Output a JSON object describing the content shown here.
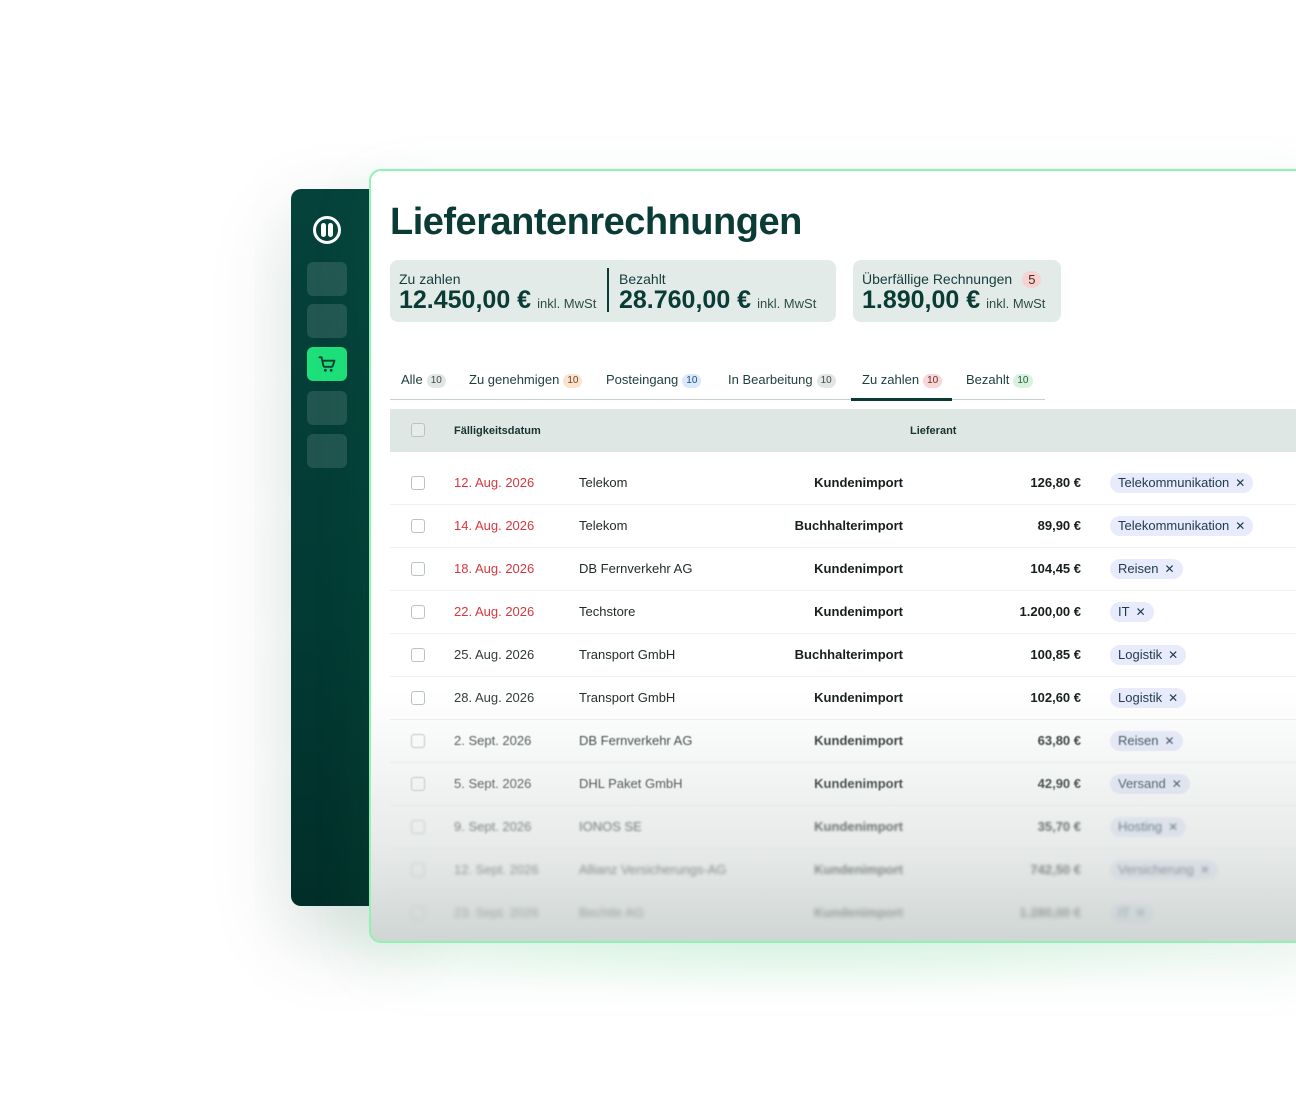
{
  "page": {
    "title": "Lieferantenrechnungen"
  },
  "sidebar": {
    "items": [
      "logo",
      "item-1",
      "item-2",
      "purchases",
      "item-4",
      "item-5"
    ],
    "active_color": "#1ee07a"
  },
  "summary": {
    "to_pay": {
      "label": "Zu zahlen",
      "value": "12.450,00 €",
      "unit": "inkl. MwSt"
    },
    "paid": {
      "label": "Bezahlt",
      "value": "28.760,00 €",
      "unit": "inkl. MwSt"
    },
    "overdue": {
      "label": "Überfällige Rechnungen",
      "count": "5",
      "value": "1.890,00 €",
      "unit": "inkl. MwSt"
    }
  },
  "tabs": [
    {
      "label": "Alle",
      "count": "10"
    },
    {
      "label": "Zu genehmigen",
      "count": "10"
    },
    {
      "label": "Posteingang",
      "count": "10"
    },
    {
      "label": "In Bearbeitung",
      "count": "10"
    },
    {
      "label": "Zu zahlen",
      "count": "10",
      "active": true
    },
    {
      "label": "Bezahlt",
      "count": "10"
    }
  ],
  "table": {
    "headers": {
      "due_date": "Fälligkeitsdatum",
      "vendor": "Lieferant"
    },
    "rows": [
      {
        "date": "12. Aug. 2026",
        "vendor": "Telekom",
        "import": "Kundenimport",
        "amount": "126,80 €",
        "tag": "Telekommunikation",
        "overdue": true
      },
      {
        "date": "14. Aug. 2026",
        "vendor": "Telekom",
        "import": "Buchhalterimport",
        "amount": "89,90 €",
        "tag": "Telekommunikation",
        "overdue": true
      },
      {
        "date": "18. Aug. 2026",
        "vendor": "DB Fernverkehr AG",
        "import": "Kundenimport",
        "amount": "104,45 €",
        "tag": "Reisen",
        "overdue": true
      },
      {
        "date": "22. Aug. 2026",
        "vendor": "Techstore",
        "import": "Kundenimport",
        "amount": "1.200,00 €",
        "tag": "IT",
        "overdue": true
      },
      {
        "date": "25. Aug. 2026",
        "vendor": "Transport GmbH",
        "import": "Buchhalterimport",
        "amount": "100,85 €",
        "tag": "Logistik",
        "overdue": false
      },
      {
        "date": "28. Aug. 2026",
        "vendor": "Transport GmbH",
        "import": "Kundenimport",
        "amount": "102,60 €",
        "tag": "Logistik",
        "overdue": false
      },
      {
        "date": "2. Sept. 2026",
        "vendor": "DB Fernverkehr AG",
        "import": "Kundenimport",
        "amount": "63,80 €",
        "tag": "Reisen",
        "overdue": false
      },
      {
        "date": "5. Sept. 2026",
        "vendor": "DHL Paket GmbH",
        "import": "Kundenimport",
        "amount": "42,90 €",
        "tag": "Versand",
        "overdue": false
      },
      {
        "date": "9. Sept. 2026",
        "vendor": "IONOS SE",
        "import": "Kundenimport",
        "amount": "35,70 €",
        "tag": "Hosting",
        "overdue": false
      },
      {
        "date": "12. Sept. 2026",
        "vendor": "Allianz Versicherungs-AG",
        "import": "Kundenimport",
        "amount": "742,50 €",
        "tag": "Versicherung",
        "overdue": false
      },
      {
        "date": "23. Sept. 2026",
        "vendor": "Bechtle AG",
        "import": "Kundenimport",
        "amount": "1.280,00 €",
        "tag": "IT",
        "overdue": false
      }
    ]
  }
}
